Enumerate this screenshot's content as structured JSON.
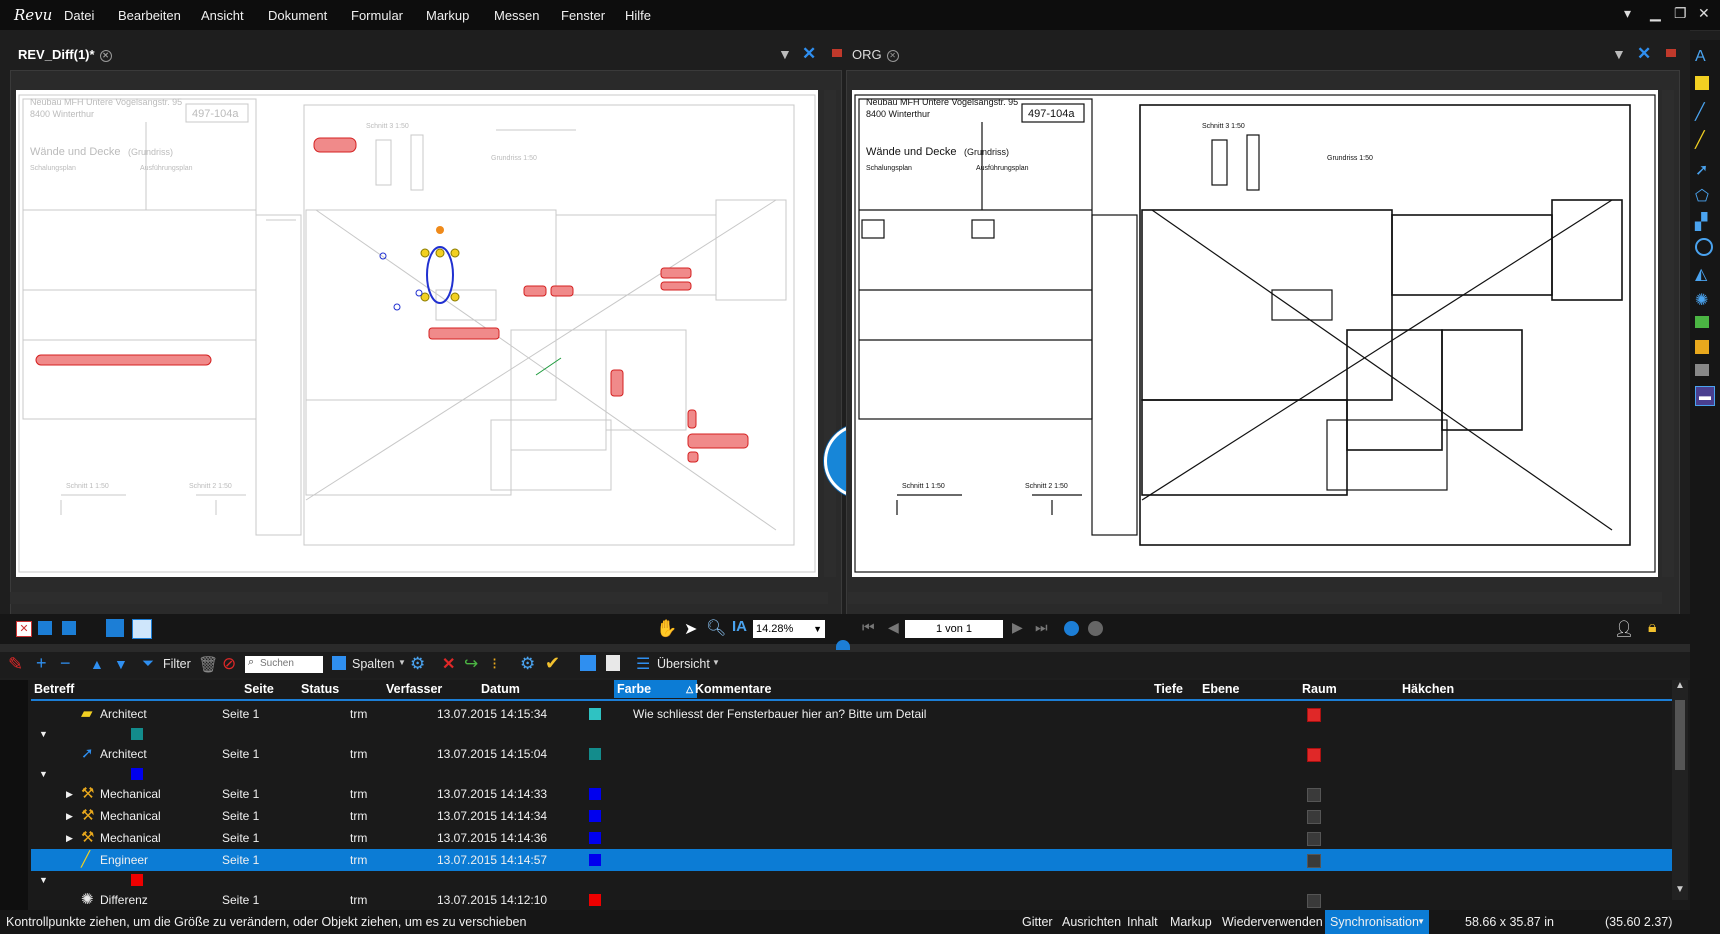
{
  "app": {
    "logo_text": "Revu"
  },
  "menu": [
    "Datei",
    "Bearbeiten",
    "Ansicht",
    "Dokument",
    "Formular",
    "Markup",
    "Messen",
    "Fenster",
    "Hilfe"
  ],
  "left_pane": {
    "tab_title": "REV_Diff(1)*",
    "title_block": {
      "project": "Neubau MFH Untere Vogelsangstr. 95",
      "city": "8400 Winterthur",
      "drawing_no": "497-104a",
      "title": "Wände und Decke",
      "subtitle": "(Grundriss)",
      "plan_type": "Schalungsplan",
      "phase": "Ausführungsplan"
    },
    "labels": {
      "section3": "Schnitt 3 1:50",
      "floorplan": "Grundriss 1:50",
      "section1": "Schnitt 1 1:50",
      "section2": "Schnitt 2 1:50"
    }
  },
  "right_pane": {
    "tab_title": "ORG",
    "title_block": {
      "project": "Neubau MFH Untere Vogelsangstr. 95",
      "city": "8400 Winterthur",
      "drawing_no": "497-104a",
      "title": "Wände und Decke",
      "subtitle": "(Grundriss)",
      "plan_type": "Schalungsplan",
      "phase": "Ausführungsplan"
    },
    "labels": {
      "section3": "Schnitt 3 1:50",
      "floorplan": "Grundriss 1:50",
      "section1": "Schnitt 1 1:50",
      "section2": "Schnitt 2 1:50"
    }
  },
  "view_toolbar": {
    "zoom": "14.28%",
    "page": "1 von 1"
  },
  "markup_toolbar": {
    "filter": "Filter",
    "search_placeholder": "Suchen",
    "columns": "Spalten",
    "overview": "Übersicht"
  },
  "columns": [
    "Betreff",
    "Seite",
    "Status",
    "Verfasser",
    "Datum",
    "Farbe",
    "Kommentare",
    "Tiefe",
    "Ebene",
    "Raum",
    "Häkchen"
  ],
  "rows": [
    {
      "kind": "item",
      "subject": "Architect",
      "page": "Seite 1",
      "author": "trm",
      "date": "13.07.2015 14:15:34",
      "color": "#2fc2c2",
      "comment": "Wie schliesst der Fensterbauer hier an? Bitte um Detail",
      "checked": true,
      "icon": "note-icon"
    },
    {
      "kind": "group",
      "color": "#138c8c"
    },
    {
      "kind": "item",
      "subject": "Architect",
      "page": "Seite 1",
      "author": "trm",
      "date": "13.07.2015 14:15:04",
      "color": "#138c8c",
      "comment": "",
      "checked": true,
      "icon": "arrow-icon"
    },
    {
      "kind": "group",
      "color": "#0000ee"
    },
    {
      "kind": "item",
      "subject": "Mechanical",
      "page": "Seite 1",
      "author": "trm",
      "date": "13.07.2015 14:14:33",
      "color": "#0000ee",
      "comment": "",
      "checked": false,
      "icon": "mechanical-icon",
      "expandable": true
    },
    {
      "kind": "item",
      "subject": "Mechanical",
      "page": "Seite 1",
      "author": "trm",
      "date": "13.07.2015 14:14:34",
      "color": "#0000ee",
      "comment": "",
      "checked": false,
      "icon": "mechanical-icon",
      "expandable": true
    },
    {
      "kind": "item",
      "subject": "Mechanical",
      "page": "Seite 1",
      "author": "trm",
      "date": "13.07.2015 14:14:36",
      "color": "#0000ee",
      "comment": "",
      "checked": false,
      "icon": "mechanical-icon",
      "expandable": true
    },
    {
      "kind": "item",
      "subject": "Engineer",
      "page": "Seite 1",
      "author": "trm",
      "date": "13.07.2015 14:14:57",
      "color": "#0000ee",
      "comment": "",
      "checked": false,
      "icon": "pen-icon",
      "selected": true
    },
    {
      "kind": "group",
      "color": "#ee0000"
    },
    {
      "kind": "item",
      "subject": "Differenz",
      "page": "Seite 1",
      "author": "trm",
      "date": "13.07.2015 14:12:10",
      "color": "#ee0000",
      "comment": "",
      "checked": false,
      "icon": "cloud-icon"
    }
  ],
  "status": {
    "hint": "Kontrollpunkte ziehen, um die Größe zu verändern, oder Objekt ziehen, um es zu verschieben",
    "buttons": [
      "Gitter",
      "Ausrichten",
      "Inhalt",
      "Markup",
      "Wiederverwenden"
    ],
    "sync": "Synchronisation",
    "size": "58.66 x 35.87 in",
    "coords": "(35.60  2.37)"
  }
}
